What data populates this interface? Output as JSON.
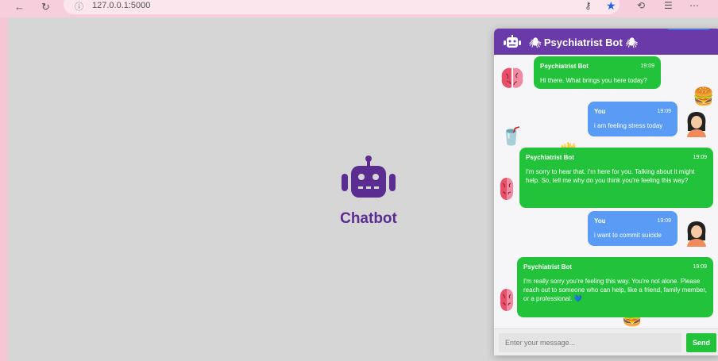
{
  "browser": {
    "url": "127.0.0.1:5000"
  },
  "launcher": {
    "title": "Chatbot",
    "accent": "#5b2d91"
  },
  "chat": {
    "header_title": "Psychiatrist Bot",
    "header_color": "#6a3aa8",
    "bot_color": "#22c33a",
    "user_color": "#5a9cf5",
    "messages": [
      {
        "sender": "Psychiatrist Bot",
        "time": "19:09",
        "text": "Hi there. What brings you here today?",
        "role": "bot"
      },
      {
        "sender": "You",
        "time": "19:09",
        "text": "i am feeling stress today",
        "role": "user"
      },
      {
        "sender": "Psychiatrist Bot",
        "time": "19:09",
        "text": "I'm sorry to hear that. I'm here for you. Talking about it might help. So, tell me why do you think you're feeling this way?",
        "role": "bot"
      },
      {
        "sender": "You",
        "time": "19:09",
        "text": "i want to commit suicide",
        "role": "user"
      },
      {
        "sender": "Psychiatrist Bot",
        "time": "19:09",
        "text": "I'm really sorry you're feeling this way. You're not alone. Please reach out to someone who can help, like a friend, family member, or a professional. 💙",
        "role": "bot"
      }
    ],
    "input": {
      "placeholder": "Enter your message...",
      "value": ""
    },
    "send_label": "Send"
  }
}
